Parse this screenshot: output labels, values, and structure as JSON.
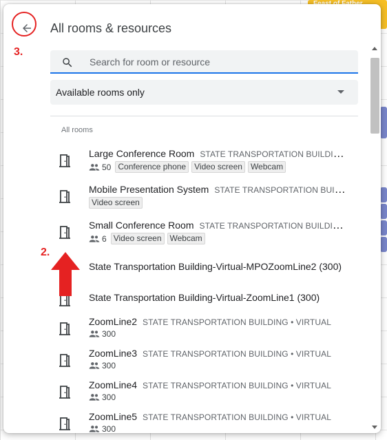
{
  "background": {
    "event_label": "Feast of Father"
  },
  "dialog": {
    "title": "All rooms & resources",
    "back_icon": "arrow-left-icon",
    "search": {
      "placeholder": "Search for room or resource",
      "value": ""
    },
    "filter": {
      "selected": "Available rooms only"
    },
    "section_header": "All rooms",
    "rooms": [
      {
        "name": "Large Conference Room",
        "building": "STATE TRANSPORTATION BUILDING • ...",
        "capacity": "50",
        "features": [
          "Conference phone",
          "Video screen",
          "Webcam"
        ]
      },
      {
        "name": "Mobile Presentation System",
        "building": "STATE TRANSPORTATION BUILDI...",
        "capacity": "",
        "features": [
          "Video screen"
        ]
      },
      {
        "name": "Small Conference Room",
        "building": "STATE TRANSPORTATION BUILDING • ...",
        "capacity": "6",
        "features": [
          "Video screen",
          "Webcam"
        ]
      },
      {
        "name": "State Transportation Building-Virtual-MPOZoomLine2 (300)"
      },
      {
        "name": "State Transportation Building-Virtual-ZoomLine1 (300)"
      },
      {
        "name": "ZoomLine2",
        "building": "STATE TRANSPORTATION BUILDING • VIRTUAL",
        "capacity": "300"
      },
      {
        "name": "ZoomLine3",
        "building": "STATE TRANSPORTATION BUILDING • VIRTUAL",
        "capacity": "300"
      },
      {
        "name": "ZoomLine4",
        "building": "STATE TRANSPORTATION BUILDING • VIRTUAL",
        "capacity": "300"
      },
      {
        "name": "ZoomLine5",
        "building": "STATE TRANSPORTATION BUILDING • VIRTUAL",
        "capacity": "300"
      }
    ]
  },
  "annotations": {
    "label_2": "2.",
    "label_3": "3."
  },
  "colors": {
    "accent": "#1a73e8",
    "annotation": "#e52222"
  }
}
